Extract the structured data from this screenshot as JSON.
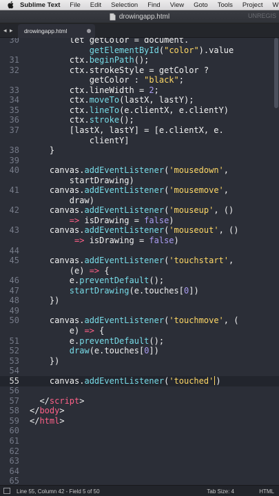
{
  "menubar": {
    "app_name": "Sublime Text",
    "items": [
      "File",
      "Edit",
      "Selection",
      "Find",
      "View",
      "Goto",
      "Tools",
      "Project",
      "Wind"
    ]
  },
  "window": {
    "title": "drowingapp.html",
    "unregistered": "UNREGIS"
  },
  "tabs": {
    "nav": "◂ ▸",
    "active": "drowingapp.html"
  },
  "editor": {
    "current_line": "55",
    "lines": [
      {
        "n": "30",
        "tok": [
          [
            "v",
            "        let getColor = document."
          ]
        ]
      },
      {
        "n": "",
        "tok": [
          [
            "v",
            "            "
          ],
          [
            "f",
            "getElementById"
          ],
          [
            "v",
            "("
          ],
          [
            "s",
            "\"color\""
          ],
          [
            "v",
            ").value"
          ]
        ]
      },
      {
        "n": "31",
        "tok": [
          [
            "v",
            "        ctx."
          ],
          [
            "f",
            "beginPath"
          ],
          [
            "v",
            "();"
          ]
        ]
      },
      {
        "n": "32",
        "tok": [
          [
            "v",
            "        ctx.strokeStyle = getColor ?"
          ]
        ]
      },
      {
        "n": "",
        "tok": [
          [
            "v",
            "            getColor : "
          ],
          [
            "s",
            "\"black\""
          ],
          [
            "v",
            ";"
          ]
        ]
      },
      {
        "n": "33",
        "tok": [
          [
            "v",
            "        ctx.lineWidth = "
          ],
          [
            "b",
            "2"
          ],
          [
            "v",
            ";"
          ]
        ]
      },
      {
        "n": "34",
        "tok": [
          [
            "v",
            "        ctx."
          ],
          [
            "f",
            "moveTo"
          ],
          [
            "v",
            "(lastX, lastY);"
          ]
        ]
      },
      {
        "n": "35",
        "tok": [
          [
            "v",
            "        ctx."
          ],
          [
            "f",
            "lineTo"
          ],
          [
            "v",
            "(e.clientX, e.clientY)"
          ]
        ]
      },
      {
        "n": "36",
        "tok": [
          [
            "v",
            "        ctx."
          ],
          [
            "f",
            "stroke"
          ],
          [
            "v",
            "();"
          ]
        ]
      },
      {
        "n": "37",
        "tok": [
          [
            "v",
            "        [lastX, lastY] = [e.clientX, e."
          ]
        ]
      },
      {
        "n": "",
        "tok": [
          [
            "v",
            "            clientY]"
          ]
        ]
      },
      {
        "n": "38",
        "tok": [
          [
            "v",
            "    }"
          ]
        ]
      },
      {
        "n": "39",
        "tok": []
      },
      {
        "n": "40",
        "tok": [
          [
            "v",
            "    canvas."
          ],
          [
            "f",
            "addEventListener"
          ],
          [
            "v",
            "("
          ],
          [
            "s",
            "'mousedown'"
          ],
          [
            "v",
            ","
          ]
        ]
      },
      {
        "n": "",
        "tok": [
          [
            "v",
            "        startDrawing)"
          ]
        ]
      },
      {
        "n": "41",
        "tok": [
          [
            "v",
            "    canvas."
          ],
          [
            "f",
            "addEventListener"
          ],
          [
            "v",
            "("
          ],
          [
            "s",
            "'mousemove'"
          ],
          [
            "v",
            ","
          ]
        ]
      },
      {
        "n": "",
        "tok": [
          [
            "v",
            "        draw)"
          ]
        ]
      },
      {
        "n": "42",
        "tok": [
          [
            "v",
            "    canvas."
          ],
          [
            "f",
            "addEventListener"
          ],
          [
            "v",
            "("
          ],
          [
            "s",
            "'mouseup'"
          ],
          [
            "v",
            ", ()"
          ]
        ]
      },
      {
        "n": "",
        "tok": [
          [
            "v",
            "        "
          ],
          [
            "k",
            "=>"
          ],
          [
            "v",
            " isDrawing = "
          ],
          [
            "b",
            "false"
          ],
          [
            "v",
            ")"
          ]
        ]
      },
      {
        "n": "43",
        "tok": [
          [
            "v",
            "    canvas."
          ],
          [
            "f",
            "addEventListener"
          ],
          [
            "v",
            "("
          ],
          [
            "s",
            "'mouseout'"
          ],
          [
            "v",
            ", ()"
          ]
        ]
      },
      {
        "n": "",
        "tok": [
          [
            "v",
            "         "
          ],
          [
            "k",
            "=>"
          ],
          [
            "v",
            " isDrawing = "
          ],
          [
            "b",
            "false"
          ],
          [
            "v",
            ")"
          ]
        ]
      },
      {
        "n": "44",
        "tok": []
      },
      {
        "n": "45",
        "tok": [
          [
            "v",
            "    canvas."
          ],
          [
            "f",
            "addEventListener"
          ],
          [
            "v",
            "("
          ],
          [
            "s",
            "'touchstart'"
          ],
          [
            "v",
            ","
          ]
        ]
      },
      {
        "n": "",
        "tok": [
          [
            "v",
            "        (e) "
          ],
          [
            "k",
            "=>"
          ],
          [
            "v",
            " {"
          ]
        ]
      },
      {
        "n": "46",
        "tok": [
          [
            "v",
            "        e."
          ],
          [
            "f",
            "preventDefault"
          ],
          [
            "v",
            "();"
          ]
        ]
      },
      {
        "n": "47",
        "tok": [
          [
            "v",
            "        "
          ],
          [
            "f",
            "startDrawing"
          ],
          [
            "v",
            "(e.touches["
          ],
          [
            "b",
            "0"
          ],
          [
            "v",
            "])"
          ]
        ]
      },
      {
        "n": "48",
        "tok": [
          [
            "v",
            "    })"
          ]
        ]
      },
      {
        "n": "49",
        "tok": []
      },
      {
        "n": "50",
        "tok": [
          [
            "v",
            "    canvas."
          ],
          [
            "f",
            "addEventListener"
          ],
          [
            "v",
            "("
          ],
          [
            "s",
            "'touchmove'"
          ],
          [
            "v",
            ", ("
          ]
        ]
      },
      {
        "n": "",
        "tok": [
          [
            "v",
            "        e) "
          ],
          [
            "k",
            "=>"
          ],
          [
            "v",
            " {"
          ]
        ]
      },
      {
        "n": "51",
        "tok": [
          [
            "v",
            "        e."
          ],
          [
            "f",
            "preventDefault"
          ],
          [
            "v",
            "();"
          ]
        ]
      },
      {
        "n": "52",
        "tok": [
          [
            "v",
            "        "
          ],
          [
            "f",
            "draw"
          ],
          [
            "v",
            "(e.touches["
          ],
          [
            "b",
            "0"
          ],
          [
            "v",
            "])"
          ]
        ]
      },
      {
        "n": "53",
        "tok": [
          [
            "v",
            "    })"
          ]
        ]
      },
      {
        "n": "54",
        "tok": []
      },
      {
        "n": "55",
        "tok": [
          [
            "v",
            "    canvas."
          ],
          [
            "f",
            "addEventListener"
          ],
          [
            "v",
            "("
          ],
          [
            "s",
            "'touched'"
          ],
          [
            "cur",
            ""
          ],
          [
            "v",
            ")"
          ]
        ]
      },
      {
        "n": "56",
        "tok": []
      },
      {
        "n": "57",
        "tok": [
          [
            "v",
            "  </"
          ],
          [
            "k",
            "script"
          ],
          [
            "v",
            ">"
          ]
        ]
      },
      {
        "n": "58",
        "tok": [
          [
            "v",
            "</"
          ],
          [
            "k",
            "body"
          ],
          [
            "v",
            ">"
          ]
        ]
      },
      {
        "n": "59",
        "tok": [
          [
            "v",
            "</"
          ],
          [
            "k",
            "html"
          ],
          [
            "v",
            ">"
          ]
        ]
      },
      {
        "n": "60",
        "tok": []
      },
      {
        "n": "61",
        "tok": []
      },
      {
        "n": "62",
        "tok": []
      },
      {
        "n": "63",
        "tok": []
      },
      {
        "n": "64",
        "tok": []
      },
      {
        "n": "65",
        "tok": []
      }
    ]
  },
  "statusbar": {
    "position": "Line 55, Column 42 - Field 5 of 50",
    "tab_size": "Tab Size: 4",
    "syntax": "HTML"
  },
  "colors": {
    "background": "#2b2e37",
    "keyword": "#ff6188",
    "string": "#ffd866",
    "function": "#78dce8",
    "constant": "#ab9df2"
  }
}
